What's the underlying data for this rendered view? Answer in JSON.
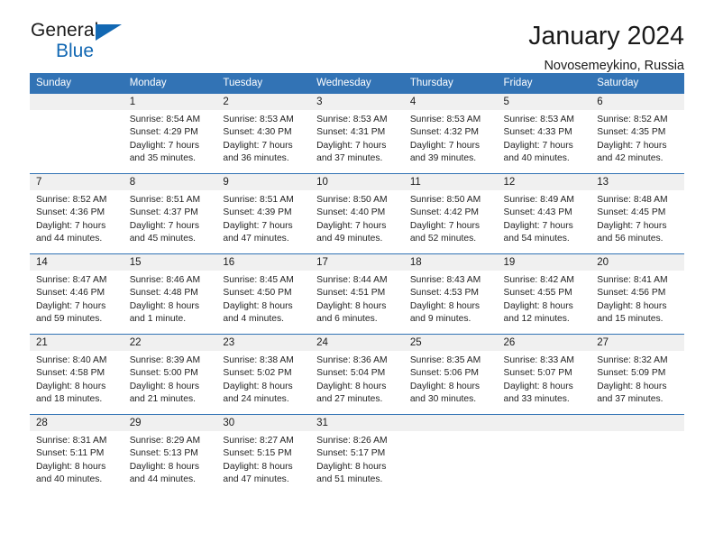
{
  "brand": {
    "name_primary": "General",
    "name_secondary": "Blue",
    "accent_color": "#1268b3"
  },
  "header": {
    "title": "January 2024",
    "subtitle": "Novosemeykino, Russia"
  },
  "calendar": {
    "header_bg": "#3273b5",
    "daynum_bg": "#f0f0f0",
    "weekday_headers": [
      "Sunday",
      "Monday",
      "Tuesday",
      "Wednesday",
      "Thursday",
      "Friday",
      "Saturday"
    ],
    "labels": {
      "sunrise_prefix": "Sunrise:",
      "sunset_prefix": "Sunset:",
      "daylight_prefix": "Daylight:"
    },
    "weeks": [
      [
        {
          "day": "",
          "sunrise": "",
          "sunset": "",
          "daylight": ""
        },
        {
          "day": "1",
          "sunrise": "Sunrise: 8:54 AM",
          "sunset": "Sunset: 4:29 PM",
          "daylight": "Daylight: 7 hours and 35 minutes."
        },
        {
          "day": "2",
          "sunrise": "Sunrise: 8:53 AM",
          "sunset": "Sunset: 4:30 PM",
          "daylight": "Daylight: 7 hours and 36 minutes."
        },
        {
          "day": "3",
          "sunrise": "Sunrise: 8:53 AM",
          "sunset": "Sunset: 4:31 PM",
          "daylight": "Daylight: 7 hours and 37 minutes."
        },
        {
          "day": "4",
          "sunrise": "Sunrise: 8:53 AM",
          "sunset": "Sunset: 4:32 PM",
          "daylight": "Daylight: 7 hours and 39 minutes."
        },
        {
          "day": "5",
          "sunrise": "Sunrise: 8:53 AM",
          "sunset": "Sunset: 4:33 PM",
          "daylight": "Daylight: 7 hours and 40 minutes."
        },
        {
          "day": "6",
          "sunrise": "Sunrise: 8:52 AM",
          "sunset": "Sunset: 4:35 PM",
          "daylight": "Daylight: 7 hours and 42 minutes."
        }
      ],
      [
        {
          "day": "7",
          "sunrise": "Sunrise: 8:52 AM",
          "sunset": "Sunset: 4:36 PM",
          "daylight": "Daylight: 7 hours and 44 minutes."
        },
        {
          "day": "8",
          "sunrise": "Sunrise: 8:51 AM",
          "sunset": "Sunset: 4:37 PM",
          "daylight": "Daylight: 7 hours and 45 minutes."
        },
        {
          "day": "9",
          "sunrise": "Sunrise: 8:51 AM",
          "sunset": "Sunset: 4:39 PM",
          "daylight": "Daylight: 7 hours and 47 minutes."
        },
        {
          "day": "10",
          "sunrise": "Sunrise: 8:50 AM",
          "sunset": "Sunset: 4:40 PM",
          "daylight": "Daylight: 7 hours and 49 minutes."
        },
        {
          "day": "11",
          "sunrise": "Sunrise: 8:50 AM",
          "sunset": "Sunset: 4:42 PM",
          "daylight": "Daylight: 7 hours and 52 minutes."
        },
        {
          "day": "12",
          "sunrise": "Sunrise: 8:49 AM",
          "sunset": "Sunset: 4:43 PM",
          "daylight": "Daylight: 7 hours and 54 minutes."
        },
        {
          "day": "13",
          "sunrise": "Sunrise: 8:48 AM",
          "sunset": "Sunset: 4:45 PM",
          "daylight": "Daylight: 7 hours and 56 minutes."
        }
      ],
      [
        {
          "day": "14",
          "sunrise": "Sunrise: 8:47 AM",
          "sunset": "Sunset: 4:46 PM",
          "daylight": "Daylight: 7 hours and 59 minutes."
        },
        {
          "day": "15",
          "sunrise": "Sunrise: 8:46 AM",
          "sunset": "Sunset: 4:48 PM",
          "daylight": "Daylight: 8 hours and 1 minute."
        },
        {
          "day": "16",
          "sunrise": "Sunrise: 8:45 AM",
          "sunset": "Sunset: 4:50 PM",
          "daylight": "Daylight: 8 hours and 4 minutes."
        },
        {
          "day": "17",
          "sunrise": "Sunrise: 8:44 AM",
          "sunset": "Sunset: 4:51 PM",
          "daylight": "Daylight: 8 hours and 6 minutes."
        },
        {
          "day": "18",
          "sunrise": "Sunrise: 8:43 AM",
          "sunset": "Sunset: 4:53 PM",
          "daylight": "Daylight: 8 hours and 9 minutes."
        },
        {
          "day": "19",
          "sunrise": "Sunrise: 8:42 AM",
          "sunset": "Sunset: 4:55 PM",
          "daylight": "Daylight: 8 hours and 12 minutes."
        },
        {
          "day": "20",
          "sunrise": "Sunrise: 8:41 AM",
          "sunset": "Sunset: 4:56 PM",
          "daylight": "Daylight: 8 hours and 15 minutes."
        }
      ],
      [
        {
          "day": "21",
          "sunrise": "Sunrise: 8:40 AM",
          "sunset": "Sunset: 4:58 PM",
          "daylight": "Daylight: 8 hours and 18 minutes."
        },
        {
          "day": "22",
          "sunrise": "Sunrise: 8:39 AM",
          "sunset": "Sunset: 5:00 PM",
          "daylight": "Daylight: 8 hours and 21 minutes."
        },
        {
          "day": "23",
          "sunrise": "Sunrise: 8:38 AM",
          "sunset": "Sunset: 5:02 PM",
          "daylight": "Daylight: 8 hours and 24 minutes."
        },
        {
          "day": "24",
          "sunrise": "Sunrise: 8:36 AM",
          "sunset": "Sunset: 5:04 PM",
          "daylight": "Daylight: 8 hours and 27 minutes."
        },
        {
          "day": "25",
          "sunrise": "Sunrise: 8:35 AM",
          "sunset": "Sunset: 5:06 PM",
          "daylight": "Daylight: 8 hours and 30 minutes."
        },
        {
          "day": "26",
          "sunrise": "Sunrise: 8:33 AM",
          "sunset": "Sunset: 5:07 PM",
          "daylight": "Daylight: 8 hours and 33 minutes."
        },
        {
          "day": "27",
          "sunrise": "Sunrise: 8:32 AM",
          "sunset": "Sunset: 5:09 PM",
          "daylight": "Daylight: 8 hours and 37 minutes."
        }
      ],
      [
        {
          "day": "28",
          "sunrise": "Sunrise: 8:31 AM",
          "sunset": "Sunset: 5:11 PM",
          "daylight": "Daylight: 8 hours and 40 minutes."
        },
        {
          "day": "29",
          "sunrise": "Sunrise: 8:29 AM",
          "sunset": "Sunset: 5:13 PM",
          "daylight": "Daylight: 8 hours and 44 minutes."
        },
        {
          "day": "30",
          "sunrise": "Sunrise: 8:27 AM",
          "sunset": "Sunset: 5:15 PM",
          "daylight": "Daylight: 8 hours and 47 minutes."
        },
        {
          "day": "31",
          "sunrise": "Sunrise: 8:26 AM",
          "sunset": "Sunset: 5:17 PM",
          "daylight": "Daylight: 8 hours and 51 minutes."
        },
        {
          "day": "",
          "sunrise": "",
          "sunset": "",
          "daylight": ""
        },
        {
          "day": "",
          "sunrise": "",
          "sunset": "",
          "daylight": ""
        },
        {
          "day": "",
          "sunrise": "",
          "sunset": "",
          "daylight": ""
        }
      ]
    ]
  }
}
